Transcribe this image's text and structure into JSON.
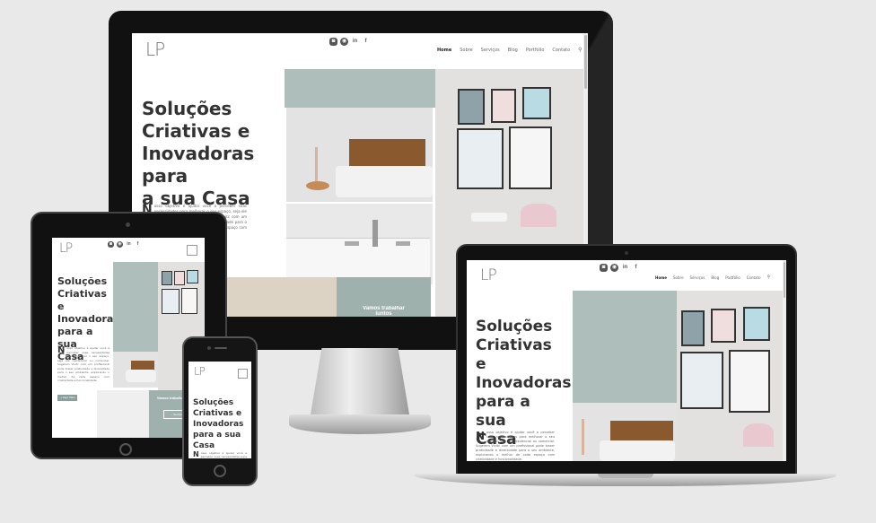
{
  "site": {
    "logo": "LP",
    "socials": [
      "◙",
      "◉",
      "in",
      "f"
    ],
    "nav": [
      "Home",
      "Sobre",
      "Serviços",
      "Blog",
      "Portfólio",
      "Contato"
    ],
    "hero_title_lines": [
      "Soluções",
      "Criativas e",
      "Inovadoras para",
      "a sua Casa"
    ],
    "hero_title_lines_narrow": [
      "Soluções",
      "Criativas e",
      "Inovadoras",
      "para a sua",
      "Casa"
    ],
    "intro_dropcap": "N",
    "intro_text": "osso objetivo é ajudar você a perceber suas necessidades para melhorar o seu espaço, seja ele residencial ou comercial. Sugerem Vivitc com um profissional pode trazer praticidade e diversidade para o seu ambiente, explorando o melhor de cada espaço com criatividade e funcionalidade.",
    "cta_title": "Vamos trabalhar juntos",
    "cta_button": "→ Serviços",
    "scroll_button": "→ Veja Mais"
  },
  "colors": {
    "mint": "#aebfbb",
    "wood": "#8a5a2e",
    "accent_btn": "#8c9e9a"
  }
}
